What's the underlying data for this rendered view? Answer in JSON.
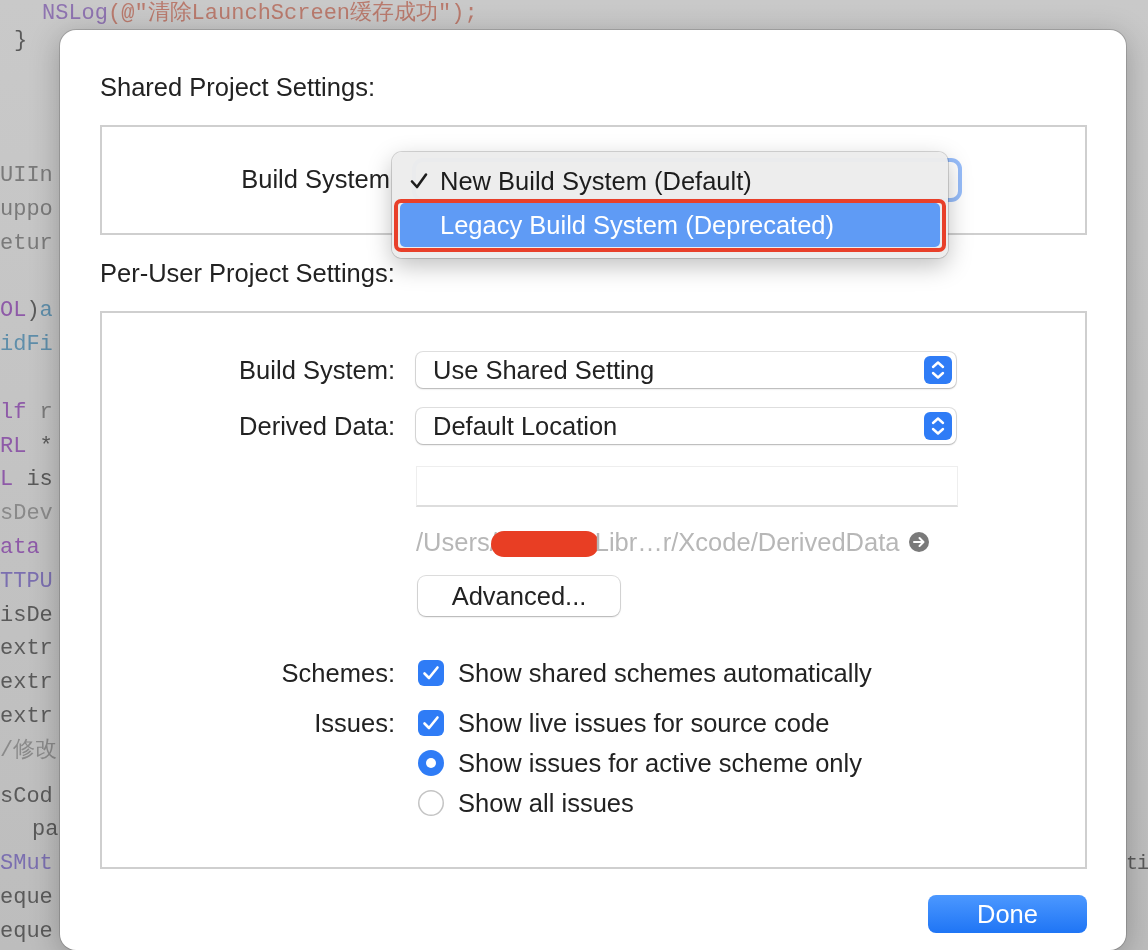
{
  "background_code": {
    "lines": [
      {
        "spans": [
          {
            "text": "NSLog",
            "color": "#8e73b0"
          },
          {
            "text": "(@\"清除LaunchScreen缓存成功\");",
            "color": "#b97a6d"
          }
        ]
      },
      {
        "spans": [
          {
            "text": "}",
            "color": "#5a5a5a"
          }
        ]
      },
      {
        "spans": [
          {
            "text": "UIIn",
            "color": "#7a7a7a"
          }
        ]
      },
      {
        "spans": [
          {
            "text": "uppo",
            "color": "#7a7a7a"
          }
        ]
      },
      {
        "spans": [
          {
            "text": "etur",
            "color": "#7a7a7a"
          }
        ]
      },
      {
        "spans": [
          {
            "text": "OL",
            "color": "#8e5aa8"
          },
          {
            "text": ")",
            "color": "#5a5a5a"
          },
          {
            "text": "a",
            "color": "#5f8eaa"
          }
        ]
      },
      {
        "spans": [
          {
            "text": "idFi",
            "color": "#5f8eaa"
          }
        ]
      },
      {
        "spans": [
          {
            "text": "lf",
            "color": "#8e5aa8"
          },
          {
            "text": "r",
            "color": "#7a7a7a"
          }
        ]
      },
      {
        "spans": [
          {
            "text": "RL",
            "color": "#8e5aa8"
          },
          {
            "text": "*",
            "color": "#5a5a5a"
          }
        ]
      },
      {
        "spans": [
          {
            "text": "L",
            "color": "#8e5aa8"
          },
          {
            "text": "is",
            "color": "#5a5a5a"
          }
        ]
      },
      {
        "spans": [
          {
            "text": "sDev",
            "color": "#8a8a8a"
          }
        ]
      },
      {
        "spans": [
          {
            "text": "ata",
            "color": "#8e5aa8"
          }
        ]
      },
      {
        "spans": [
          {
            "text": "TTPU",
            "color": "#7b6fb0"
          }
        ]
      },
      {
        "spans": [
          {
            "text": "isDe",
            "color": "#5a5a5a"
          }
        ]
      },
      {
        "spans": [
          {
            "text": "extr",
            "color": "#5a5a5a"
          }
        ]
      },
      {
        "spans": [
          {
            "text": "extr",
            "color": "#5a5a5a"
          }
        ]
      },
      {
        "spans": [
          {
            "text": "extr",
            "color": "#5a5a5a"
          }
        ]
      },
      {
        "spans": [
          {
            "text": "/修改",
            "color": "#8a8a8a"
          }
        ]
      },
      {
        "spans": [
          {
            "text": "sCod",
            "color": "#5a5a5a"
          }
        ]
      },
      {
        "spans": [
          {
            "text": "pa",
            "color": "#5a5a5a"
          }
        ]
      },
      {
        "spans": [
          {
            "text": "SMut",
            "color": "#7b6fb0"
          }
        ],
        "tail": "ti"
      },
      {
        "spans": [
          {
            "text": "eque",
            "color": "#5a5a5a"
          }
        ]
      },
      {
        "spans": [
          {
            "text": "eque",
            "color": "#5a5a5a"
          }
        ]
      }
    ]
  },
  "dialog": {
    "shared_section": {
      "title": "Shared Project Settings:",
      "build_system": {
        "label": "Build System",
        "menu": {
          "items": [
            {
              "label": "New Build System (Default)",
              "checked": true,
              "selected": false,
              "annotated": false
            },
            {
              "label": "Legacy Build System (Deprecated)",
              "checked": false,
              "selected": true,
              "annotated": true
            }
          ]
        }
      }
    },
    "per_user_section": {
      "title": "Per-User Project Settings:",
      "build_system": {
        "label": "Build System:",
        "value": "Use Shared Setting"
      },
      "derived_data": {
        "label": "Derived Data:",
        "value": "Default Location"
      },
      "path": {
        "prefix": "/Users/",
        "suffix": "Libr…r/Xcode/DerivedData"
      },
      "advanced_button": "Advanced...",
      "groups": [
        {
          "label": "Schemes:",
          "options": [
            {
              "kind": "checkbox",
              "label": "Show shared schemes automatically",
              "checked": true
            }
          ]
        },
        {
          "label": "Issues:",
          "options": [
            {
              "kind": "checkbox",
              "label": "Show live issues for source code",
              "checked": true
            },
            {
              "kind": "radio",
              "label": "Show issues for active scheme only",
              "selected": true
            },
            {
              "kind": "radio",
              "label": "Show all issues",
              "selected": false
            }
          ]
        }
      ]
    },
    "done_button": "Done"
  }
}
